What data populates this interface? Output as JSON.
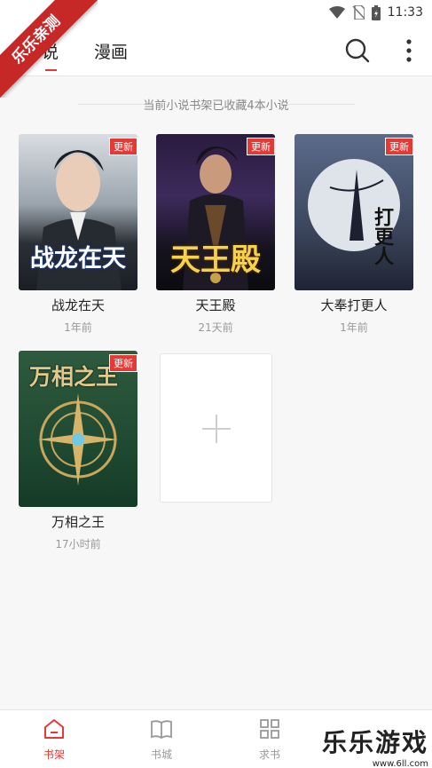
{
  "status_bar": {
    "time": "11:33"
  },
  "watermark_corner": "乐乐亲测",
  "header": {
    "tabs": [
      {
        "label": "小说",
        "active": true
      },
      {
        "label": "漫画",
        "active": false
      }
    ]
  },
  "summary": "当前小说书架已收藏4本小说",
  "books": [
    {
      "title": "战龙在天",
      "time": "1年前",
      "badge": "更新",
      "cover_title": "战龙在天"
    },
    {
      "title": "天王殿",
      "time": "21天前",
      "badge": "更新",
      "cover_title": "天王殿"
    },
    {
      "title": "大奉打更人",
      "time": "1年前",
      "badge": "更新",
      "cover_title": "打更人"
    },
    {
      "title": "万相之王",
      "time": "17小时前",
      "badge": "更新",
      "cover_title": "万相之王"
    }
  ],
  "bottom_nav": [
    {
      "label": "书架",
      "icon": "home-icon",
      "active": true
    },
    {
      "label": "书城",
      "icon": "book-open-icon",
      "active": false
    },
    {
      "label": "求书",
      "icon": "grid-icon",
      "active": false
    }
  ],
  "watermark": {
    "text": "乐乐游戏",
    "url": "www.6ll.com"
  },
  "colors": {
    "accent": "#e53935",
    "background": "#f7f7f7"
  }
}
